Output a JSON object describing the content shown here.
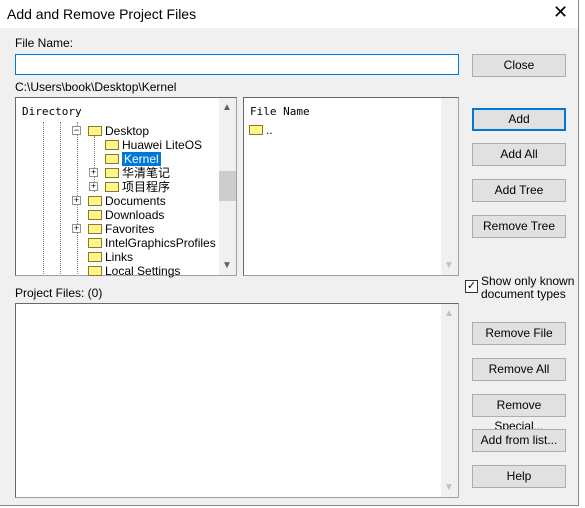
{
  "window": {
    "title": "Add and Remove Project Files"
  },
  "file_name": {
    "label": "File Name:",
    "value": ""
  },
  "current_path": "C:\\Users\\book\\Desktop\\Kernel",
  "directory": {
    "header": "Directory",
    "items": [
      {
        "label": "Desktop",
        "expander": "minus",
        "level": 2
      },
      {
        "label": "Huawei LiteOS",
        "level": 3
      },
      {
        "label": "Kernel",
        "level": 3,
        "selected": true
      },
      {
        "label": "华清笔记",
        "expander": "plus",
        "level": 3
      },
      {
        "label": "项目程序",
        "expander": "plus",
        "level": 3
      },
      {
        "label": "Documents",
        "expander": "plus",
        "level": 2
      },
      {
        "label": "Downloads",
        "level": 2
      },
      {
        "label": "Favorites",
        "expander": "plus",
        "level": 2
      },
      {
        "label": "IntelGraphicsProfiles",
        "level": 2
      },
      {
        "label": "Links",
        "level": 2
      },
      {
        "label": "Local Settings",
        "level": 2
      }
    ]
  },
  "files": {
    "header": "File Name",
    "items": [
      ".."
    ]
  },
  "project_files": {
    "label": "Project Files: (0)",
    "items": []
  },
  "show_known": {
    "label1": "Show only known",
    "label2": "document types",
    "checked": true
  },
  "buttons": {
    "close": "Close",
    "add": "Add",
    "add_all": "Add All",
    "add_tree": "Add Tree",
    "remove_tree": "Remove Tree",
    "remove_file": "Remove File",
    "remove_all": "Remove All",
    "remove_special": "Remove Special...",
    "add_from_list": "Add from list...",
    "help": "Help"
  },
  "colors": {
    "accent": "#0078d7"
  }
}
